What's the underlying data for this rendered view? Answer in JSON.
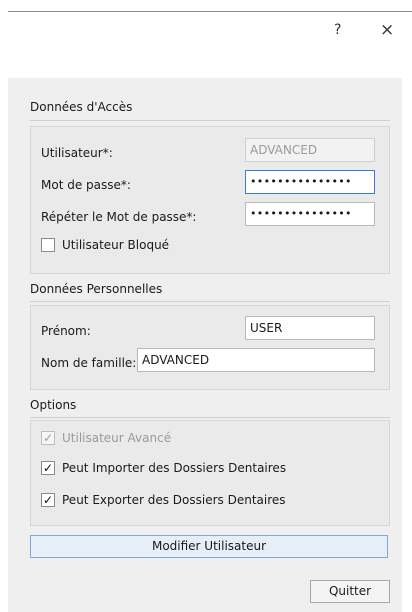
{
  "window": {
    "help_glyph": "?",
    "close_glyph": "×"
  },
  "access": {
    "title": "Données d'Accès",
    "user_label": "Utilisateur*:",
    "user_value": "ADVANCED",
    "password_label": "Mot de passe*:",
    "password_value": "•••••••••••••••",
    "repeat_label": "Répéter le Mot de passe*:",
    "repeat_value": "•••••••••••••••",
    "blocked_label": "Utilisateur Bloqué",
    "blocked_checked": false
  },
  "personal": {
    "title": "Données Personnelles",
    "firstname_label": "Prénom:",
    "firstname_value": "USER",
    "lastname_label": "Nom de famille:",
    "lastname_value": "ADVANCED"
  },
  "options": {
    "title": "Options",
    "items": [
      {
        "label": "Utilisateur Avancé",
        "checked": true,
        "disabled": true
      },
      {
        "label": "Peut Importer des Dossiers Dentaires",
        "checked": true,
        "disabled": false
      },
      {
        "label": "Peut Exporter des Dossiers Dentaires",
        "checked": true,
        "disabled": false
      }
    ],
    "check_glyph": "✓"
  },
  "actions": {
    "modify_label": "Modifier Utilisateur",
    "quit_label": "Quitter"
  }
}
